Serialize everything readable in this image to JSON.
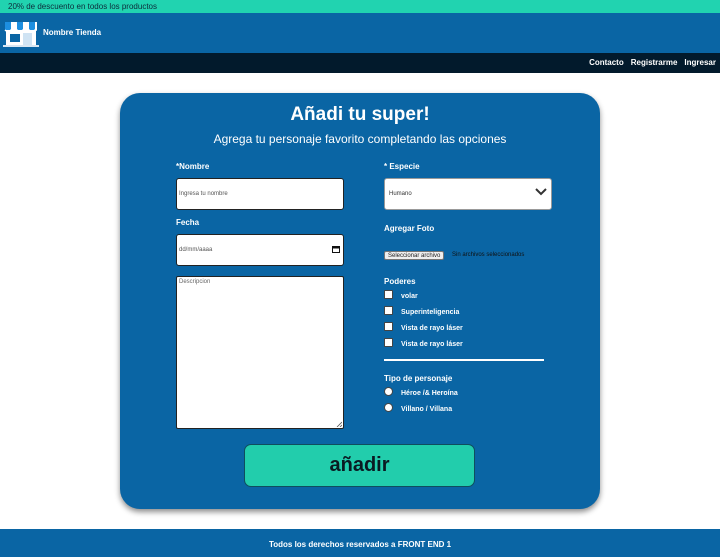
{
  "promo": {
    "text": "20% de descuento en todos los productos"
  },
  "header": {
    "store_name": "Nombre Tienda"
  },
  "nav": {
    "contact": "Contacto",
    "register": "Registrarme",
    "login": "Ingresar"
  },
  "form": {
    "title": "Añadi tu super!",
    "subtitle": "Agrega tu personaje favorito completando las opciones",
    "name_label": "*Nombre",
    "name_placeholder": "Ingresa tu nombre",
    "species_label": "* Especie",
    "species_value": "Humano",
    "date_label": "Fecha",
    "date_placeholder": "dd/mm/aaaa",
    "photo_label": "Agregar Foto",
    "file_button": "Seleccionar archivo",
    "file_status": "Sin archivos seleccionados",
    "description_placeholder": "Descripcion",
    "powers_label": "Poderes",
    "powers": [
      "volar",
      "Superinteligencia",
      "Vista de rayo láser",
      "Vista de rayo láser"
    ],
    "type_label": "Tipo de personaje",
    "types": [
      "Héroe /& Heroína",
      "Villano / Villana"
    ],
    "submit_label": "añadir"
  },
  "footer": {
    "text": "Todos los derechos reservados a FRONT END 1"
  },
  "colors": {
    "primary": "#0a65a4",
    "accent": "#21d3b0",
    "navbar": "#021a2c"
  }
}
